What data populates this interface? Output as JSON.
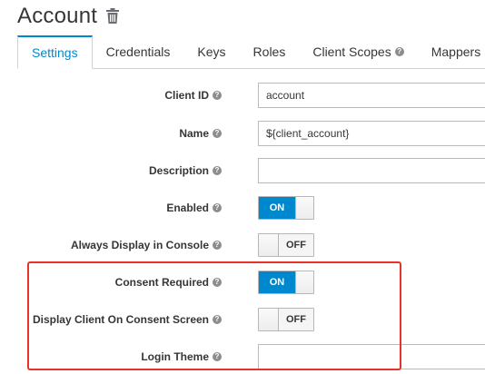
{
  "page": {
    "title": "Account"
  },
  "tabs": [
    {
      "label": "Settings",
      "active": true
    },
    {
      "label": "Credentials",
      "active": false
    },
    {
      "label": "Keys",
      "active": false
    },
    {
      "label": "Roles",
      "active": false
    },
    {
      "label": "Client Scopes",
      "active": false,
      "help": true
    },
    {
      "label": "Mappers",
      "active": false
    }
  ],
  "form": {
    "client_id": {
      "label": "Client ID",
      "value": "account"
    },
    "name": {
      "label": "Name",
      "value": "${client_account}"
    },
    "description": {
      "label": "Description",
      "value": ""
    },
    "enabled": {
      "label": "Enabled",
      "state": "ON"
    },
    "always_display": {
      "label": "Always Display in Console",
      "state": "OFF"
    },
    "consent_required": {
      "label": "Consent Required",
      "state": "ON"
    },
    "display_client_consent": {
      "label": "Display Client On Consent Screen",
      "state": "OFF"
    },
    "login_theme": {
      "label": "Login Theme",
      "value": ""
    }
  },
  "help_glyph": "?",
  "colors": {
    "accent": "#0088ce",
    "highlight_border": "#e8332a",
    "text": "#363636"
  }
}
